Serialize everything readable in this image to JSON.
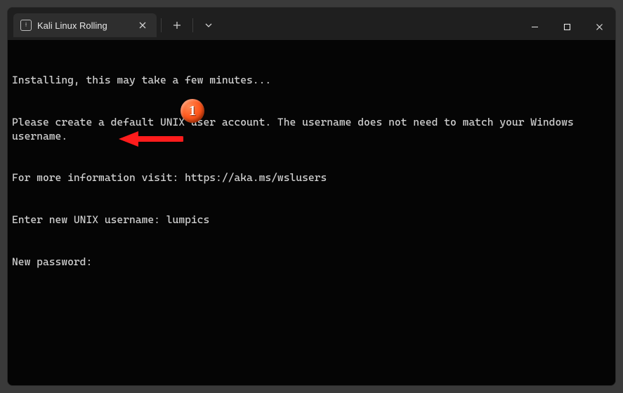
{
  "tab": {
    "title": "Kali Linux Rolling",
    "icon": "kali-icon"
  },
  "terminal": {
    "lines": [
      "Installing, this may take a few minutes...",
      "Please create a default UNIX user account. The username does not need to match your Windows username.",
      "For more information visit: https://aka.ms/wslusers"
    ],
    "prompt_username_label": "Enter new UNIX username: ",
    "prompt_username_value": "lumpics",
    "prompt_password_label": "New password: "
  },
  "annotation": {
    "badge_number": "1"
  }
}
